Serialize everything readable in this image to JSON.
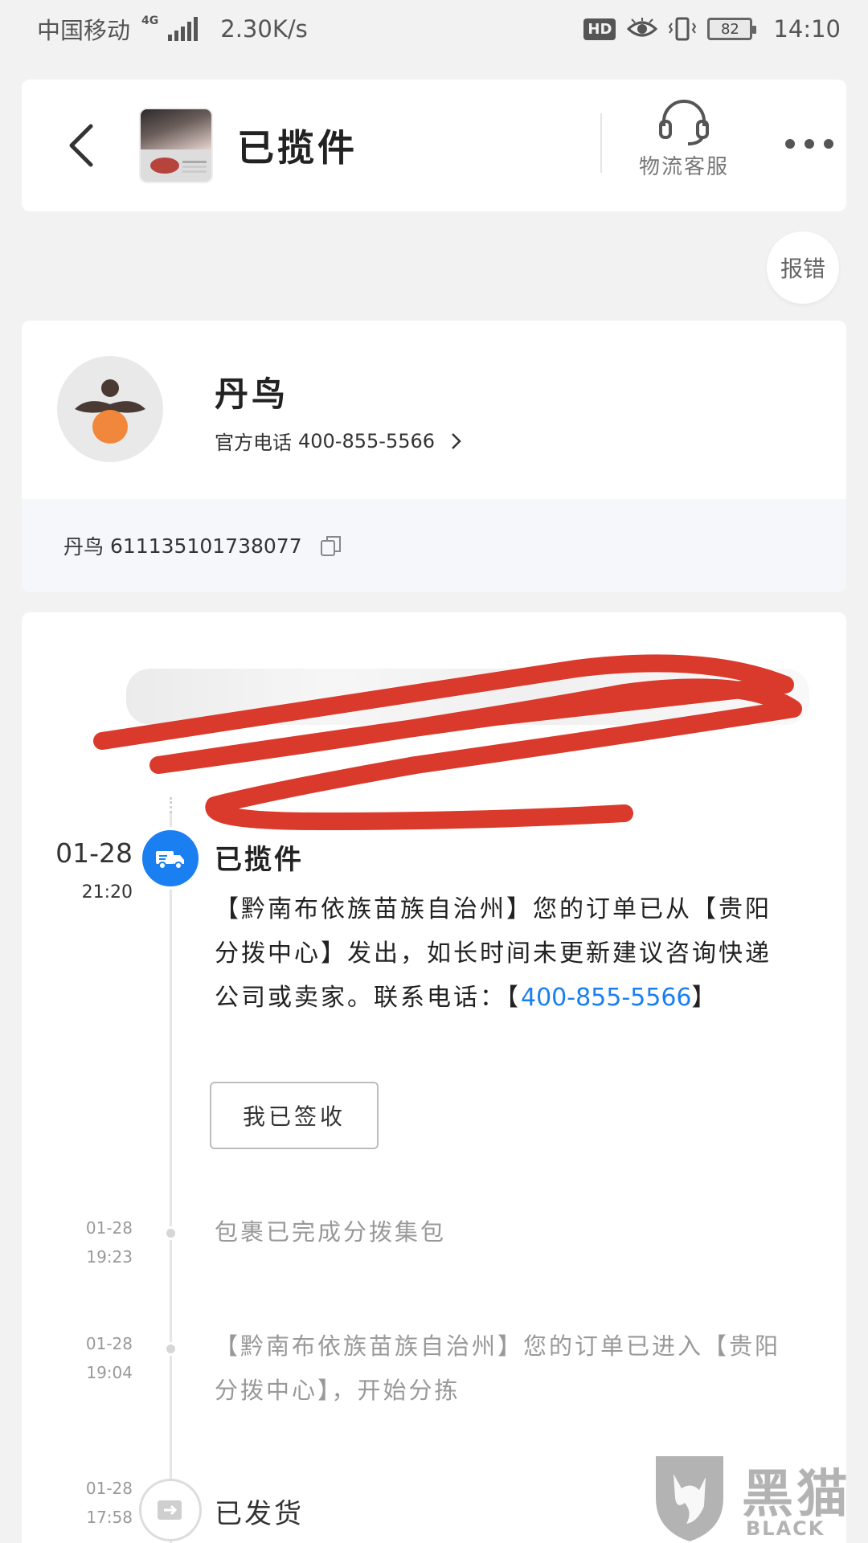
{
  "status_bar": {
    "carrier": "中国移动",
    "network": "4G",
    "speed": "2.30K/s",
    "hd": "HD",
    "battery": "82",
    "time": "14:10"
  },
  "header": {
    "title": "已揽件",
    "customer_service": "物流客服"
  },
  "report_error": "报错",
  "courier": {
    "name": "丹鸟",
    "phone_label": "官方电话",
    "phone": "400-855-5566",
    "tracking_company": "丹鸟",
    "tracking_number": "611135101738077"
  },
  "timeline": {
    "events": [
      {
        "date": "01-28",
        "time": "21:20",
        "title": "已揽件",
        "desc_prefix": "【黔南布依族苗族自治州】您的订单已从【贵阳分拨中心】发出，如长时间未更新建议咨询快递公司或卖家。联系电话：【",
        "desc_link": "400-855-5566",
        "desc_suffix": "】",
        "action": "我已签收"
      },
      {
        "date": "01-28",
        "time": "19:23",
        "desc": "包裹已完成分拨集包"
      },
      {
        "date": "01-28",
        "time": "19:04",
        "desc": "【黔南布依族苗族自治州】您的订单已进入【贵阳分拨中心】，开始分拣"
      },
      {
        "date": "01-28",
        "time": "17:58",
        "title": "已发货"
      }
    ]
  },
  "watermark": {
    "text": "黑猫",
    "sub": "BLACK CAT"
  },
  "colors": {
    "accent": "#1a7ff0",
    "scribble": "#d93a2b",
    "logo_orange": "#f0873a",
    "logo_brown": "#4a3a33"
  },
  "icons": [
    "back-icon",
    "headset-icon",
    "more-icon",
    "chevron-right-icon",
    "copy-icon",
    "truck-icon",
    "shipping-icon"
  ]
}
